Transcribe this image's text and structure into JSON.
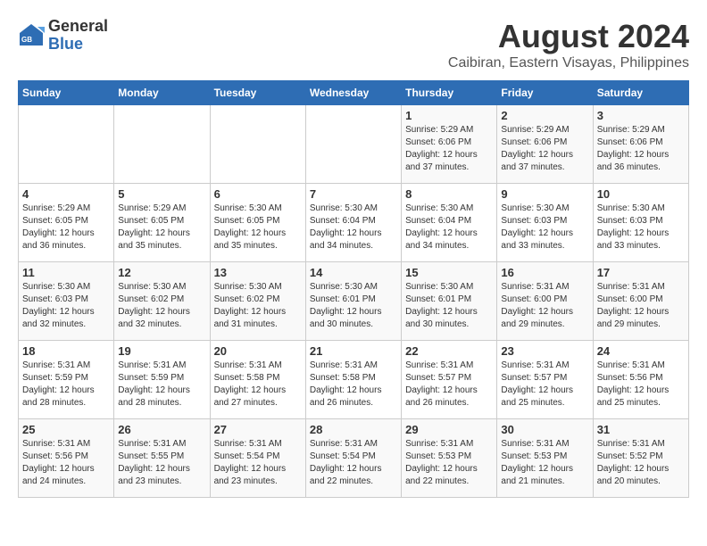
{
  "header": {
    "logo_general": "General",
    "logo_blue": "Blue",
    "month": "August 2024",
    "location": "Caibiran, Eastern Visayas, Philippines"
  },
  "weekdays": [
    "Sunday",
    "Monday",
    "Tuesday",
    "Wednesday",
    "Thursday",
    "Friday",
    "Saturday"
  ],
  "weeks": [
    [
      {
        "day": "",
        "info": ""
      },
      {
        "day": "",
        "info": ""
      },
      {
        "day": "",
        "info": ""
      },
      {
        "day": "",
        "info": ""
      },
      {
        "day": "1",
        "info": "Sunrise: 5:29 AM\nSunset: 6:06 PM\nDaylight: 12 hours\nand 37 minutes."
      },
      {
        "day": "2",
        "info": "Sunrise: 5:29 AM\nSunset: 6:06 PM\nDaylight: 12 hours\nand 37 minutes."
      },
      {
        "day": "3",
        "info": "Sunrise: 5:29 AM\nSunset: 6:06 PM\nDaylight: 12 hours\nand 36 minutes."
      }
    ],
    [
      {
        "day": "4",
        "info": "Sunrise: 5:29 AM\nSunset: 6:05 PM\nDaylight: 12 hours\nand 36 minutes."
      },
      {
        "day": "5",
        "info": "Sunrise: 5:29 AM\nSunset: 6:05 PM\nDaylight: 12 hours\nand 35 minutes."
      },
      {
        "day": "6",
        "info": "Sunrise: 5:30 AM\nSunset: 6:05 PM\nDaylight: 12 hours\nand 35 minutes."
      },
      {
        "day": "7",
        "info": "Sunrise: 5:30 AM\nSunset: 6:04 PM\nDaylight: 12 hours\nand 34 minutes."
      },
      {
        "day": "8",
        "info": "Sunrise: 5:30 AM\nSunset: 6:04 PM\nDaylight: 12 hours\nand 34 minutes."
      },
      {
        "day": "9",
        "info": "Sunrise: 5:30 AM\nSunset: 6:03 PM\nDaylight: 12 hours\nand 33 minutes."
      },
      {
        "day": "10",
        "info": "Sunrise: 5:30 AM\nSunset: 6:03 PM\nDaylight: 12 hours\nand 33 minutes."
      }
    ],
    [
      {
        "day": "11",
        "info": "Sunrise: 5:30 AM\nSunset: 6:03 PM\nDaylight: 12 hours\nand 32 minutes."
      },
      {
        "day": "12",
        "info": "Sunrise: 5:30 AM\nSunset: 6:02 PM\nDaylight: 12 hours\nand 32 minutes."
      },
      {
        "day": "13",
        "info": "Sunrise: 5:30 AM\nSunset: 6:02 PM\nDaylight: 12 hours\nand 31 minutes."
      },
      {
        "day": "14",
        "info": "Sunrise: 5:30 AM\nSunset: 6:01 PM\nDaylight: 12 hours\nand 30 minutes."
      },
      {
        "day": "15",
        "info": "Sunrise: 5:30 AM\nSunset: 6:01 PM\nDaylight: 12 hours\nand 30 minutes."
      },
      {
        "day": "16",
        "info": "Sunrise: 5:31 AM\nSunset: 6:00 PM\nDaylight: 12 hours\nand 29 minutes."
      },
      {
        "day": "17",
        "info": "Sunrise: 5:31 AM\nSunset: 6:00 PM\nDaylight: 12 hours\nand 29 minutes."
      }
    ],
    [
      {
        "day": "18",
        "info": "Sunrise: 5:31 AM\nSunset: 5:59 PM\nDaylight: 12 hours\nand 28 minutes."
      },
      {
        "day": "19",
        "info": "Sunrise: 5:31 AM\nSunset: 5:59 PM\nDaylight: 12 hours\nand 28 minutes."
      },
      {
        "day": "20",
        "info": "Sunrise: 5:31 AM\nSunset: 5:58 PM\nDaylight: 12 hours\nand 27 minutes."
      },
      {
        "day": "21",
        "info": "Sunrise: 5:31 AM\nSunset: 5:58 PM\nDaylight: 12 hours\nand 26 minutes."
      },
      {
        "day": "22",
        "info": "Sunrise: 5:31 AM\nSunset: 5:57 PM\nDaylight: 12 hours\nand 26 minutes."
      },
      {
        "day": "23",
        "info": "Sunrise: 5:31 AM\nSunset: 5:57 PM\nDaylight: 12 hours\nand 25 minutes."
      },
      {
        "day": "24",
        "info": "Sunrise: 5:31 AM\nSunset: 5:56 PM\nDaylight: 12 hours\nand 25 minutes."
      }
    ],
    [
      {
        "day": "25",
        "info": "Sunrise: 5:31 AM\nSunset: 5:56 PM\nDaylight: 12 hours\nand 24 minutes."
      },
      {
        "day": "26",
        "info": "Sunrise: 5:31 AM\nSunset: 5:55 PM\nDaylight: 12 hours\nand 23 minutes."
      },
      {
        "day": "27",
        "info": "Sunrise: 5:31 AM\nSunset: 5:54 PM\nDaylight: 12 hours\nand 23 minutes."
      },
      {
        "day": "28",
        "info": "Sunrise: 5:31 AM\nSunset: 5:54 PM\nDaylight: 12 hours\nand 22 minutes."
      },
      {
        "day": "29",
        "info": "Sunrise: 5:31 AM\nSunset: 5:53 PM\nDaylight: 12 hours\nand 22 minutes."
      },
      {
        "day": "30",
        "info": "Sunrise: 5:31 AM\nSunset: 5:53 PM\nDaylight: 12 hours\nand 21 minutes."
      },
      {
        "day": "31",
        "info": "Sunrise: 5:31 AM\nSunset: 5:52 PM\nDaylight: 12 hours\nand 20 minutes."
      }
    ]
  ]
}
